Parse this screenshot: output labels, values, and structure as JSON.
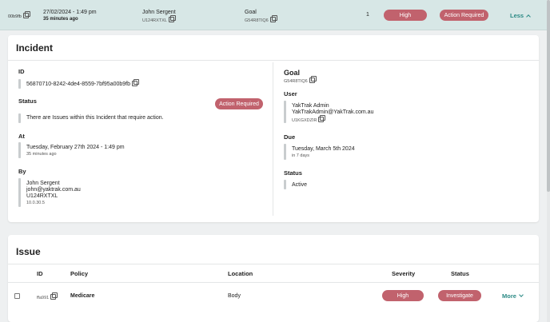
{
  "summary_row": {
    "short_id": "00b9fb",
    "datetime": "27/02/2024 - 1:49 pm",
    "relative": "35 minutes ago",
    "person_name": "John Sergent",
    "person_code": "U124RXTXL",
    "goal_label": "Goal",
    "goal_code": "G54R8TIQ6",
    "count": "1",
    "severity": "High",
    "status": "Action Required",
    "toggle_label": "Less"
  },
  "incident": {
    "title": "Incident",
    "id_label": "ID",
    "id_value": "56870710-8242-4de4-8559-7bf95a00b9fb",
    "status_label": "Status",
    "status_badge": "Action Required",
    "status_text": "There are Issues within this Incident that require action.",
    "at_label": "At",
    "at_value": "Tuesday, February 27th 2024 - 1:49 pm",
    "at_relative": "35 minutes ago",
    "by_label": "By",
    "by_name": "John Sergent",
    "by_email": "john@yaktrak.com.au",
    "by_code": "U124RXTXL",
    "by_ip": "10.0.30.5",
    "goal_title": "Goal",
    "goal_code": "G54R8TIQ6",
    "user_label": "User",
    "user_name": "YakTrak Admin",
    "user_email": "YakTrakAdmin@YakTrak.com.au",
    "user_code": "U1KGXDZIR",
    "due_label": "Due",
    "due_value": "Tuesday, March 5th 2024",
    "due_relative": "in 7 days",
    "goal_status_label": "Status",
    "goal_status_value": "Active"
  },
  "issue": {
    "title": "Issue",
    "columns": {
      "id": "ID",
      "policy": "Policy",
      "location": "Location",
      "severity": "Severity",
      "status": "Status"
    },
    "row": {
      "id": "ffa991",
      "policy": "Medicare",
      "location": "Body",
      "severity": "High",
      "status": "Investigate",
      "more_label": "More"
    }
  },
  "colors": {
    "badge": "#c1626d",
    "accent": "#2b8a85",
    "header_bg": "#d7e7e6"
  },
  "icons": [
    "copy-icon",
    "chevron-up-icon",
    "chevron-down-icon",
    "checkbox-icon"
  ]
}
